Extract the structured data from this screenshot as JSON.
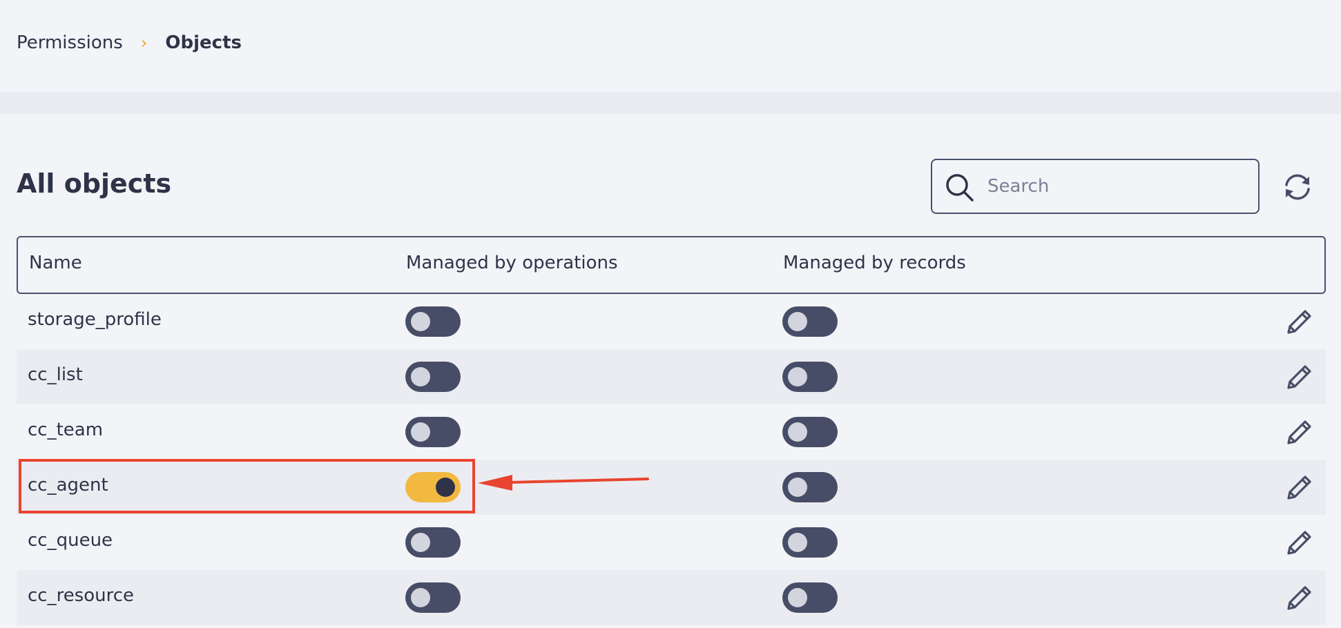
{
  "breadcrumb": {
    "root": "Permissions",
    "separator": "›",
    "current": "Objects"
  },
  "section": {
    "title": "All objects"
  },
  "search": {
    "placeholder": "Search",
    "value": ""
  },
  "table": {
    "columns": {
      "name": "Name",
      "ops": "Managed by operations",
      "records": "Managed by records"
    },
    "rows": [
      {
        "name": "storage_profile",
        "ops": false,
        "records": false
      },
      {
        "name": "cc_list",
        "ops": false,
        "records": false
      },
      {
        "name": "cc_team",
        "ops": false,
        "records": false
      },
      {
        "name": "cc_agent",
        "ops": true,
        "records": false
      },
      {
        "name": "cc_queue",
        "ops": false,
        "records": false
      },
      {
        "name": "cc_resource",
        "ops": false,
        "records": false
      }
    ]
  },
  "icons": {
    "search": "search-icon",
    "refresh": "refresh-icon",
    "edit": "pencil-icon"
  },
  "colors": {
    "accent": "#f2b941",
    "toggle_off": "#474d66",
    "annotation": "#e8442f",
    "text": "#2f3347"
  }
}
